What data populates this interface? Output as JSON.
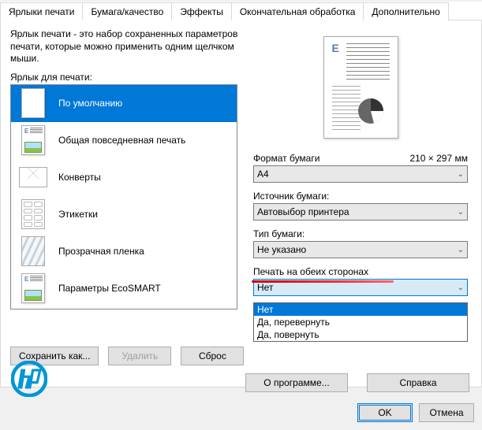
{
  "tabs": [
    {
      "label": "Ярлыки печати"
    },
    {
      "label": "Бумага/качество"
    },
    {
      "label": "Эффекты"
    },
    {
      "label": "Окончательная обработка"
    },
    {
      "label": "Дополнительно"
    }
  ],
  "shortcut": {
    "description": "Ярлык печати - это набор сохраненных параметров печати, которые можно применить одним щелчком мыши.",
    "list_label": "Ярлык для печати:",
    "items": [
      {
        "label": "По умолчанию",
        "icon": "blank"
      },
      {
        "label": "Общая повседневная печать",
        "icon": "doc"
      },
      {
        "label": "Конверты",
        "icon": "envelope"
      },
      {
        "label": "Этикетки",
        "icon": "labels"
      },
      {
        "label": "Прозрачная пленка",
        "icon": "transparency"
      },
      {
        "label": "Параметры EcoSMART",
        "icon": "doc"
      }
    ]
  },
  "buttons": {
    "save_as": "Сохранить как...",
    "delete": "Удалить",
    "reset": "Сброс",
    "about": "О программе...",
    "help": "Справка",
    "ok": "OK",
    "cancel": "Отмена"
  },
  "preview": {
    "e_letter": "E"
  },
  "form": {
    "paper_size_label": "Формат бумаги",
    "paper_size_dim": "210 × 297 мм",
    "paper_size_value": "A4",
    "paper_source_label": "Источник бумаги:",
    "paper_source_value": "Автовыбор принтера",
    "paper_type_label": "Тип бумаги:",
    "paper_type_value": "Не указано",
    "duplex_label": "Печать на обеих сторонах",
    "duplex_value": "Нет"
  },
  "duplex_options": [
    "Нет",
    "Да, перевернуть",
    "Да, повернуть"
  ]
}
